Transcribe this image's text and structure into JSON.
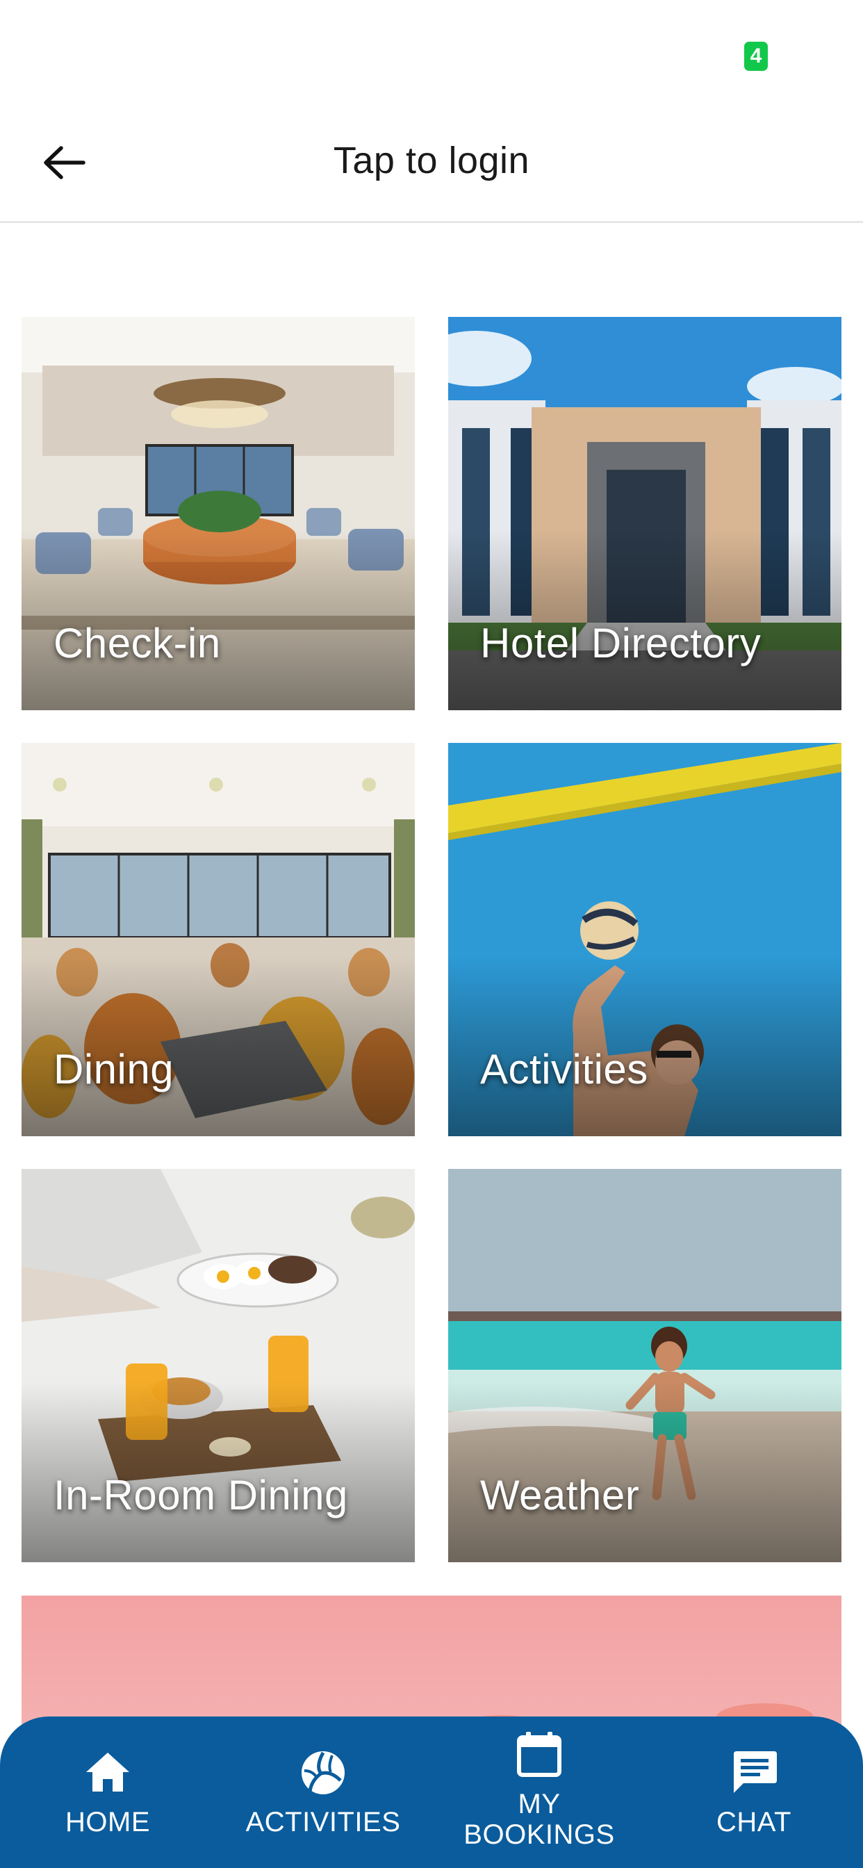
{
  "status_bar": {
    "badge_text": "4"
  },
  "header": {
    "title": "Tap to login"
  },
  "tiles": [
    {
      "label": "Check-in"
    },
    {
      "label": "Hotel Directory"
    },
    {
      "label": "Dining"
    },
    {
      "label": "Activities"
    },
    {
      "label": "In-Room Dining"
    },
    {
      "label": "Weather"
    }
  ],
  "bottom_nav": {
    "items": [
      {
        "label": "HOME",
        "icon": "home-icon"
      },
      {
        "label": "ACTIVITIES",
        "icon": "volleyball-icon"
      },
      {
        "label_line1": "MY",
        "label_line2": "BOOKINGS",
        "icon": "calendar-icon"
      },
      {
        "label": "CHAT",
        "icon": "chat-icon"
      }
    ]
  },
  "colors": {
    "nav_background": "#0a5c9c",
    "status_badge": "#12c84b",
    "banner": "#f3a2a3"
  }
}
